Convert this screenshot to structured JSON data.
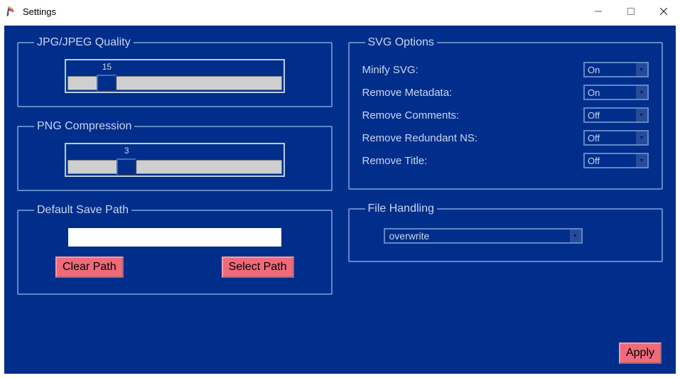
{
  "window": {
    "title": "Settings"
  },
  "jpg": {
    "legend": "JPG/JPEG Quality",
    "value": "15",
    "min": 0,
    "max": 100,
    "percent": 15
  },
  "png": {
    "legend": "PNG Compression",
    "value": "3",
    "min": 0,
    "max": 9,
    "percent": 25
  },
  "save_path": {
    "legend": "Default Save Path",
    "value": "",
    "clear_label": "Clear Path",
    "select_label": "Select Path"
  },
  "svg": {
    "legend": "SVG Options",
    "rows": [
      {
        "label": "Minify SVG:",
        "value": "On"
      },
      {
        "label": "Remove Metadata:",
        "value": "On"
      },
      {
        "label": "Remove Comments:",
        "value": "Off"
      },
      {
        "label": "Remove Redundant NS:",
        "value": "Off"
      },
      {
        "label": "Remove Title:",
        "value": "Off"
      }
    ]
  },
  "file_handling": {
    "legend": "File Handling",
    "value": "overwrite"
  },
  "apply_label": "Apply"
}
